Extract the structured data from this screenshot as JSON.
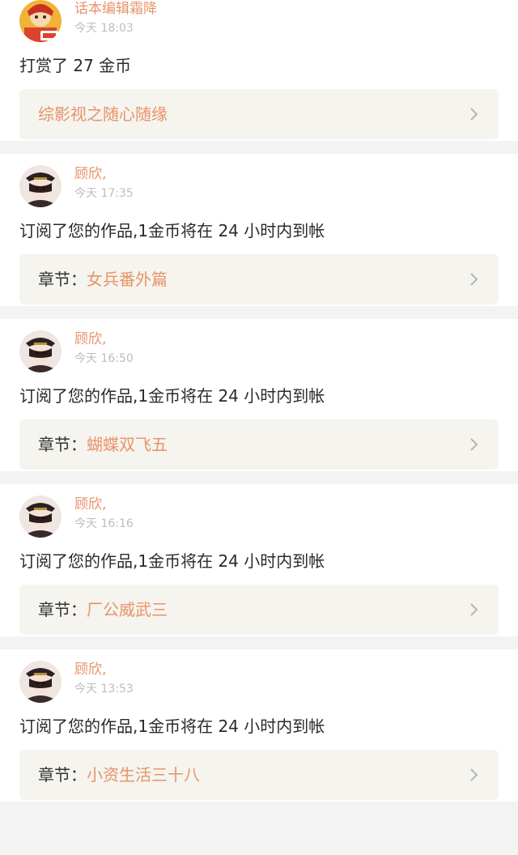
{
  "colors": {
    "accent": "#e8936a",
    "timestamp": "#bdbdbd",
    "text": "#2a2a2a",
    "link_box_bg": "#f5f4ee",
    "page_bg": "#f3f3f3"
  },
  "notifications": [
    {
      "user": "话本编辑霜降",
      "time": "今天 18:03",
      "message": "打赏了 27 金币",
      "link_prefix": "",
      "link_title": "综影视之随心随缘",
      "avatar": "editor-avatar"
    },
    {
      "user": "顾欣,",
      "time": "今天 17:35",
      "message": "订阅了您的作品,1金币将在 24 小时内到帐",
      "link_prefix": "章节：",
      "link_title": "女兵番外篇",
      "avatar": "user-avatar"
    },
    {
      "user": "顾欣,",
      "time": "今天 16:50",
      "message": "订阅了您的作品,1金币将在 24 小时内到帐",
      "link_prefix": "章节：",
      "link_title": "蝴蝶双飞五",
      "avatar": "user-avatar"
    },
    {
      "user": "顾欣,",
      "time": "今天 16:16",
      "message": "订阅了您的作品,1金币将在 24 小时内到帐",
      "link_prefix": "章节：",
      "link_title": "厂公威武三",
      "avatar": "user-avatar"
    },
    {
      "user": "顾欣,",
      "time": "今天 13:53",
      "message": "订阅了您的作品,1金币将在 24 小时内到帐",
      "link_prefix": "章节：",
      "link_title": "小资生活三十八",
      "avatar": "user-avatar"
    }
  ]
}
